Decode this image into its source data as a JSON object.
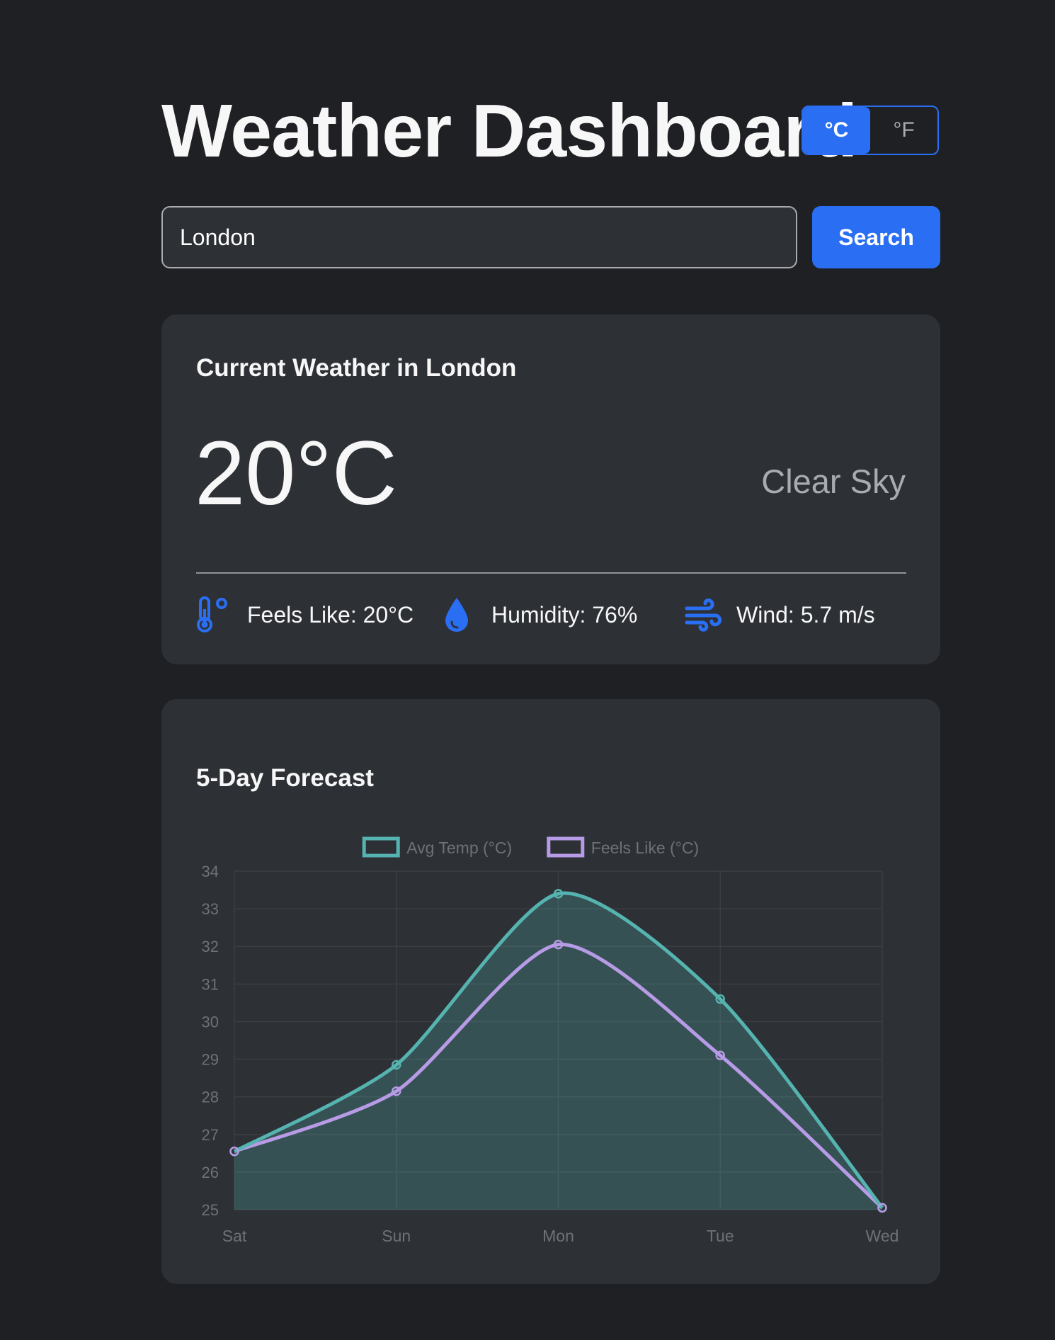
{
  "header": {
    "title": "Weather Dashboard",
    "units": [
      "°C",
      "°F"
    ],
    "active_unit": "°C"
  },
  "search": {
    "value": "London",
    "placeholder": "",
    "button_label": "Search"
  },
  "current": {
    "title": "Current Weather in London",
    "temperature": "20°C",
    "condition": "Clear Sky",
    "metrics": {
      "feels_like": {
        "icon": "thermometer-icon",
        "label": "Feels Like: 20°C"
      },
      "humidity": {
        "icon": "water-drop-icon",
        "label": "Humidity: 76%"
      },
      "wind": {
        "icon": "wind-icon",
        "label": "Wind: 5.7 m/s"
      }
    }
  },
  "forecast": {
    "title": "5-Day Forecast"
  },
  "colors": {
    "accent": "#2a6ff3",
    "background": "#1f2024",
    "card": "#2d3035",
    "avg_temp_line": "#55b3b0",
    "feels_like_line": "#b89be6"
  },
  "chart_data": {
    "type": "line",
    "categories": [
      "Sat",
      "Sun",
      "Mon",
      "Tue",
      "Wed"
    ],
    "series": [
      {
        "name": "Avg Temp (°C)",
        "values": [
          26.55,
          28.85,
          33.4,
          30.6,
          25.05
        ],
        "color": "#55b3b0",
        "fill": true
      },
      {
        "name": "Feels Like (°C)",
        "values": [
          26.55,
          28.15,
          32.05,
          29.1,
          25.05
        ],
        "color": "#b89be6",
        "fill": false
      }
    ],
    "ylim": [
      25,
      34
    ],
    "yticks": [
      25,
      26,
      27,
      28,
      29,
      30,
      31,
      32,
      33,
      34
    ],
    "grid": true,
    "legend": "top-center"
  }
}
